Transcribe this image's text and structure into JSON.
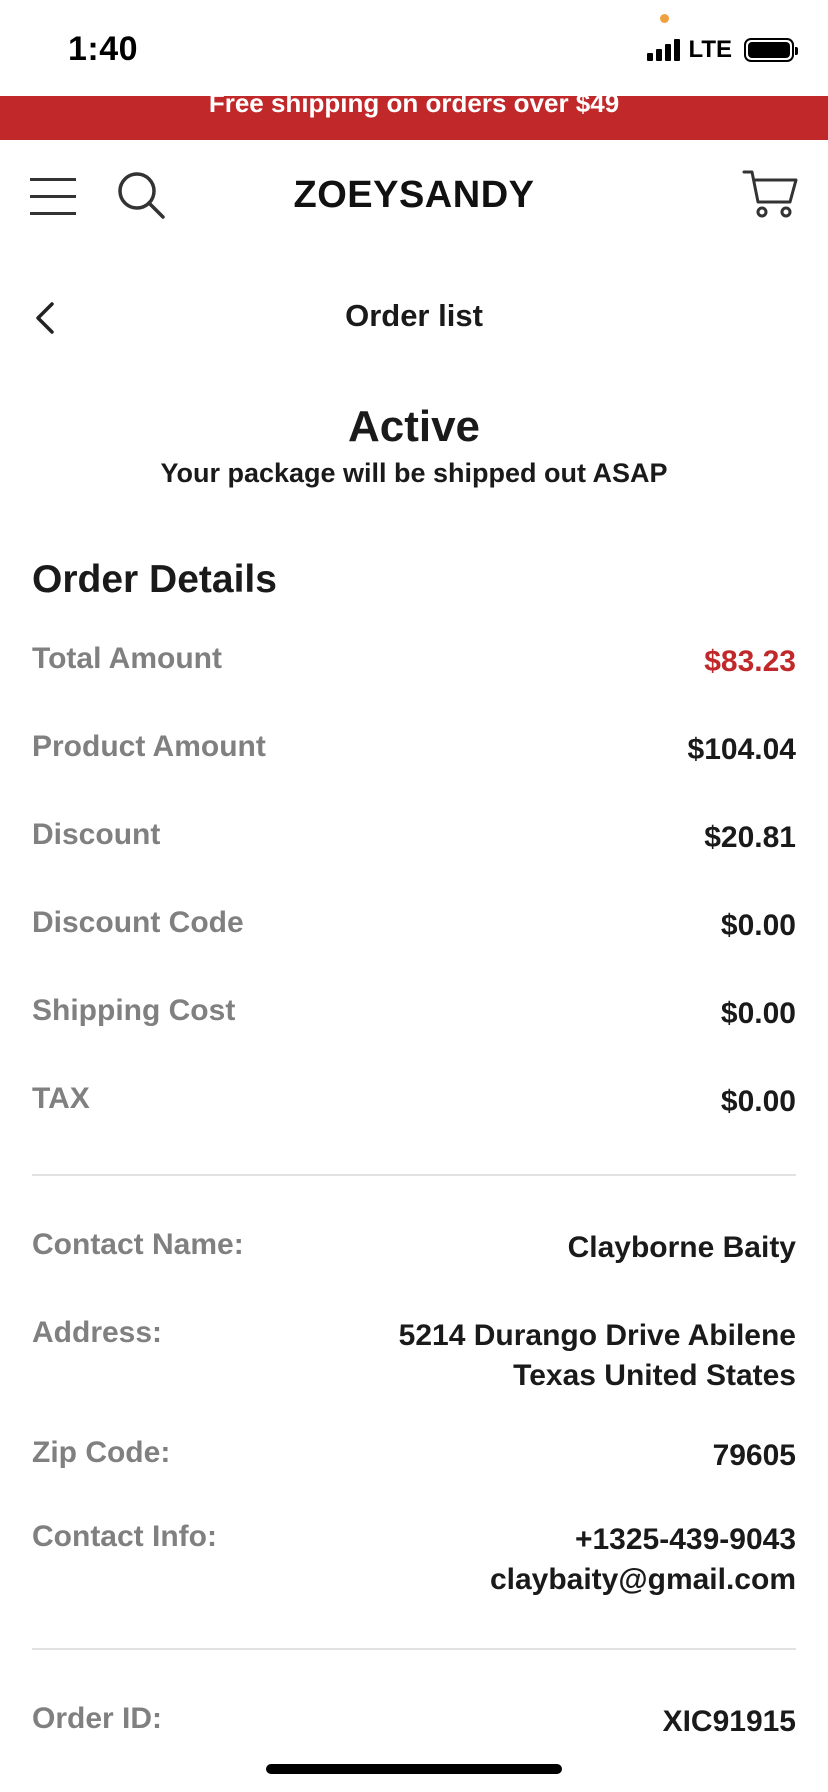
{
  "status_bar": {
    "time": "1:40",
    "network": "LTE"
  },
  "promo": {
    "text": "Free shipping on orders over $49"
  },
  "header": {
    "brand": "ZOEYSANDY"
  },
  "subheader": {
    "title": "Order list"
  },
  "order_status": {
    "title": "Active",
    "subtitle": "Your package will be shipped out ASAP"
  },
  "order_details": {
    "title": "Order Details",
    "rows": [
      {
        "label": "Total Amount",
        "value": "$83.23"
      },
      {
        "label": "Product Amount",
        "value": "$104.04"
      },
      {
        "label": "Discount",
        "value": "$20.81"
      },
      {
        "label": "Discount Code",
        "value": "$0.00"
      },
      {
        "label": "Shipping Cost",
        "value": "$0.00"
      },
      {
        "label": "TAX",
        "value": "$0.00"
      }
    ]
  },
  "contact": {
    "name_label": "Contact Name:",
    "name": "Clayborne Baity",
    "address_label": "Address:",
    "address_line1": "5214 Durango Drive Abilene",
    "address_line2": "Texas United States",
    "zip_label": "Zip Code:",
    "zip": "79605",
    "info_label": "Contact Info:",
    "phone": "+1325-439-9043",
    "email": "claybaity@gmail.com"
  },
  "order": {
    "id_label": "Order ID:",
    "id": "XIC91915"
  },
  "colors": {
    "accent_red": "#c0282a",
    "label_gray": "#808080",
    "text_dark": "#1a1a1a"
  }
}
